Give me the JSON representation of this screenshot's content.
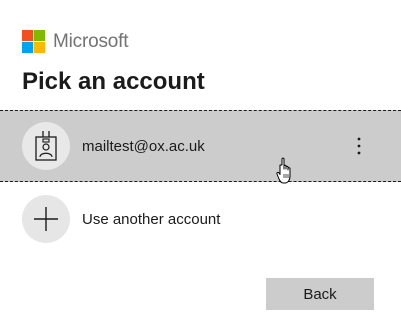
{
  "brand": {
    "name": "Microsoft",
    "logo_colors": [
      "#f25022",
      "#7fba00",
      "#00a4ef",
      "#ffb900"
    ],
    "text_color": "#737373"
  },
  "page": {
    "title": "Pick an account"
  },
  "accounts": [
    {
      "email": "mailtest@ox.ac.uk",
      "icon": "badge-person-icon",
      "options_icon": "more-options-icon",
      "selected": true
    }
  ],
  "add_account": {
    "label": "Use another account",
    "icon": "plus-icon"
  },
  "actions": {
    "back_label": "Back"
  },
  "colors": {
    "selected_tile_bg": "#cccccc",
    "avatar_bg": "#e6e6e6",
    "button_bg": "#cccccc",
    "text": "#1b1b1b"
  }
}
